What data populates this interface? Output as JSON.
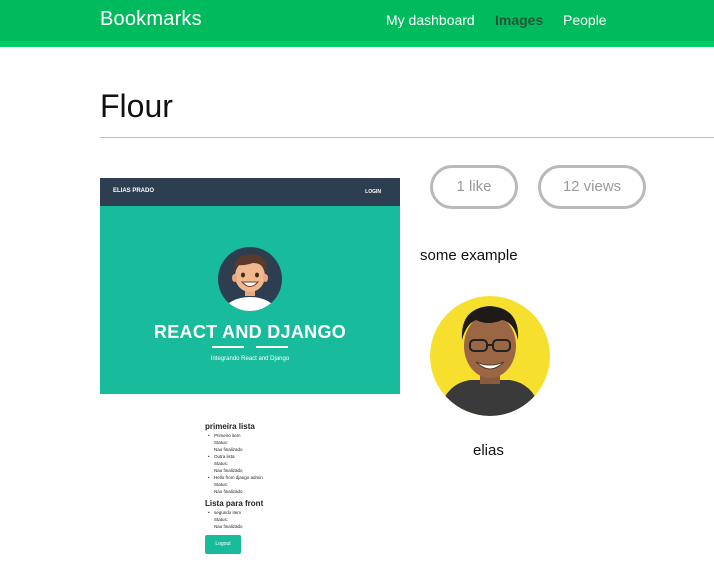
{
  "header": {
    "brand": "Bookmarks",
    "nav": [
      "My dashboard",
      "Images",
      "People"
    ],
    "active_nav": "Images",
    "colors": {
      "bar": "#00bb5e",
      "active_link": "#25563a"
    }
  },
  "page": {
    "title": "Flour"
  },
  "image": {
    "nav_brand": "ELIAS PRADO",
    "nav_login": "LOGIN",
    "hero_title": "REACT AND DJANGO",
    "hero_subtitle": "Integrando React and Django",
    "lists": [
      {
        "title": "primeira lista",
        "items": [
          {
            "name": "Primeiro item",
            "status_label": "Status:",
            "status": "Nao finalizado"
          },
          {
            "name": "Outra lista",
            "status_label": "Status:",
            "status": "Nao finalizado"
          },
          {
            "name": "Hello from django admin",
            "status_label": "Status:",
            "status": "Nao finalizado"
          }
        ]
      },
      {
        "title": "Lista para front",
        "items": [
          {
            "name": "segundo item",
            "status_label": "Status:",
            "status": "Nao finalizado"
          }
        ]
      }
    ],
    "logout_label": "Logout",
    "colors": {
      "nav": "#2c3e50",
      "hero": "#18bc9c"
    }
  },
  "stats": {
    "likes": "1 like",
    "views": "12 views"
  },
  "description": "some example",
  "user": {
    "name": "elias",
    "avatar_icon": "user-photo"
  }
}
